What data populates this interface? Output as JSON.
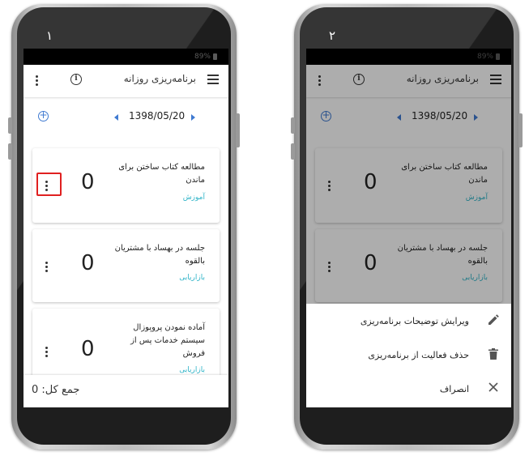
{
  "app": {
    "title": "برنامه‌ریزی روزانه",
    "status_battery": "89%",
    "date": "1398/05/20"
  },
  "tasks": [
    {
      "title": "مطالعه کتاب ساختن برای ماندن",
      "category": "آموزش",
      "count": "0"
    },
    {
      "title": "جلسه در بهساد با مشتریان بالقوه",
      "category": "بازاریابی",
      "count": "0"
    },
    {
      "title": "آماده نمودن پروپوزال سیستم خدمات پس از فروش",
      "category": "بازاریابی",
      "count": "0"
    }
  ],
  "footer": {
    "total_label": "جمع کل: 0"
  },
  "phones": [
    {
      "label": "۱"
    },
    {
      "label": "۲"
    }
  ],
  "sheet": {
    "items": [
      {
        "label": "ویرایش توضیحات برنامه‌ریزی",
        "icon": "pencil-icon"
      },
      {
        "label": "حذف فعالیت از برنامه‌ریزی",
        "icon": "trash-icon"
      },
      {
        "label": "انصراف",
        "icon": "close-icon"
      }
    ]
  },
  "colors": {
    "accent": "#3f7ad1",
    "category": "#30b4c8",
    "highlight": "#e02020"
  }
}
